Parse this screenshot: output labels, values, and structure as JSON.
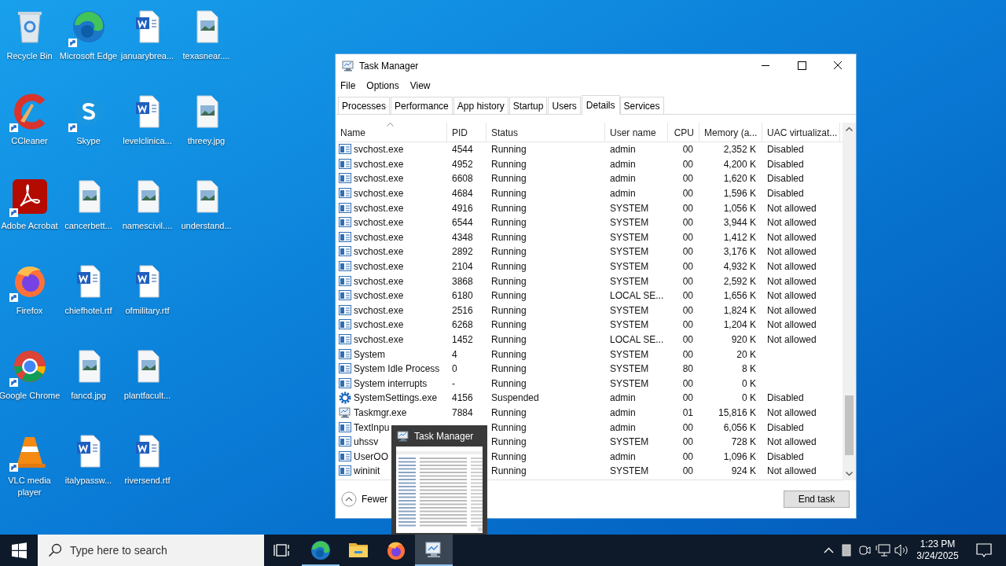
{
  "desktop_icons": [
    {
      "label": "Recycle Bin",
      "kind": "recycle",
      "shortcut": false
    },
    {
      "label": "CCleaner",
      "kind": "ccleaner",
      "shortcut": true
    },
    {
      "label": "Adobe Acrobat",
      "kind": "acrobat",
      "shortcut": true
    },
    {
      "label": "Firefox",
      "kind": "firefox",
      "shortcut": true
    },
    {
      "label": "Google Chrome",
      "kind": "chrome",
      "shortcut": true
    },
    {
      "label": "VLC media player",
      "kind": "vlc",
      "shortcut": true
    },
    {
      "label": "Microsoft Edge",
      "kind": "edge",
      "shortcut": true
    },
    {
      "label": "Skype",
      "kind": "skype",
      "shortcut": true
    },
    {
      "label": "cancerbett...",
      "kind": "image",
      "shortcut": false
    },
    {
      "label": "chiefhotel.rtf",
      "kind": "word",
      "shortcut": false
    },
    {
      "label": "fancd.jpg",
      "kind": "image",
      "shortcut": false
    },
    {
      "label": "italypassw...",
      "kind": "word",
      "shortcut": false
    },
    {
      "label": "januarybrea...",
      "kind": "word",
      "shortcut": false
    },
    {
      "label": "levelclinica...",
      "kind": "word",
      "shortcut": false
    },
    {
      "label": "namescivil....",
      "kind": "image",
      "shortcut": false
    },
    {
      "label": "ofmilitary.rtf",
      "kind": "word",
      "shortcut": false
    },
    {
      "label": "plantfacult...",
      "kind": "image",
      "shortcut": false
    },
    {
      "label": "riversend.rtf",
      "kind": "word",
      "shortcut": false
    },
    {
      "label": "texasnear....",
      "kind": "image",
      "shortcut": false
    },
    {
      "label": "threey.jpg",
      "kind": "image",
      "shortcut": false
    },
    {
      "label": "understand...",
      "kind": "image",
      "shortcut": false
    }
  ],
  "window": {
    "title": "Task Manager",
    "menu": [
      "File",
      "Options",
      "View"
    ],
    "tabs": [
      {
        "label": "Processes",
        "selected": false
      },
      {
        "label": "Performance",
        "selected": false
      },
      {
        "label": "App history",
        "selected": false
      },
      {
        "label": "Startup",
        "selected": false
      },
      {
        "label": "Users",
        "selected": false
      },
      {
        "label": "Details",
        "selected": true
      },
      {
        "label": "Services",
        "selected": false
      }
    ],
    "table": {
      "columns": [
        {
          "label": "Name",
          "sorted": true
        },
        {
          "label": "PID",
          "sorted": false
        },
        {
          "label": "Status",
          "sorted": false
        },
        {
          "label": "User name",
          "sorted": false
        },
        {
          "label": "CPU",
          "sorted": false
        },
        {
          "label": "Memory (a...",
          "sorted": false
        },
        {
          "label": "UAC virtualizat...",
          "sorted": false
        }
      ],
      "rows": [
        {
          "kind": "service",
          "name": "svchost.exe",
          "pid": "4544",
          "status": "Running",
          "user": "admin",
          "cpu": "00",
          "memory": "2,352 K",
          "uac": "Disabled"
        },
        {
          "kind": "service",
          "name": "svchost.exe",
          "pid": "4952",
          "status": "Running",
          "user": "admin",
          "cpu": "00",
          "memory": "4,200 K",
          "uac": "Disabled"
        },
        {
          "kind": "service",
          "name": "svchost.exe",
          "pid": "6608",
          "status": "Running",
          "user": "admin",
          "cpu": "00",
          "memory": "1,620 K",
          "uac": "Disabled"
        },
        {
          "kind": "service",
          "name": "svchost.exe",
          "pid": "4684",
          "status": "Running",
          "user": "admin",
          "cpu": "00",
          "memory": "1,596 K",
          "uac": "Disabled"
        },
        {
          "kind": "service",
          "name": "svchost.exe",
          "pid": "4916",
          "status": "Running",
          "user": "SYSTEM",
          "cpu": "00",
          "memory": "1,056 K",
          "uac": "Not allowed"
        },
        {
          "kind": "service",
          "name": "svchost.exe",
          "pid": "6544",
          "status": "Running",
          "user": "SYSTEM",
          "cpu": "00",
          "memory": "3,944 K",
          "uac": "Not allowed"
        },
        {
          "kind": "service",
          "name": "svchost.exe",
          "pid": "4348",
          "status": "Running",
          "user": "SYSTEM",
          "cpu": "00",
          "memory": "1,412 K",
          "uac": "Not allowed"
        },
        {
          "kind": "service",
          "name": "svchost.exe",
          "pid": "2892",
          "status": "Running",
          "user": "SYSTEM",
          "cpu": "00",
          "memory": "3,176 K",
          "uac": "Not allowed"
        },
        {
          "kind": "service",
          "name": "svchost.exe",
          "pid": "2104",
          "status": "Running",
          "user": "SYSTEM",
          "cpu": "00",
          "memory": "4,932 K",
          "uac": "Not allowed"
        },
        {
          "kind": "service",
          "name": "svchost.exe",
          "pid": "3868",
          "status": "Running",
          "user": "SYSTEM",
          "cpu": "00",
          "memory": "2,592 K",
          "uac": "Not allowed"
        },
        {
          "kind": "service",
          "name": "svchost.exe",
          "pid": "6180",
          "status": "Running",
          "user": "LOCAL SE...",
          "cpu": "00",
          "memory": "1,656 K",
          "uac": "Not allowed"
        },
        {
          "kind": "service",
          "name": "svchost.exe",
          "pid": "2516",
          "status": "Running",
          "user": "SYSTEM",
          "cpu": "00",
          "memory": "1,824 K",
          "uac": "Not allowed"
        },
        {
          "kind": "service",
          "name": "svchost.exe",
          "pid": "6268",
          "status": "Running",
          "user": "SYSTEM",
          "cpu": "00",
          "memory": "1,204 K",
          "uac": "Not allowed"
        },
        {
          "kind": "service",
          "name": "svchost.exe",
          "pid": "1452",
          "status": "Running",
          "user": "LOCAL SE...",
          "cpu": "00",
          "memory": "920 K",
          "uac": "Not allowed"
        },
        {
          "kind": "service",
          "name": "System",
          "pid": "4",
          "status": "Running",
          "user": "SYSTEM",
          "cpu": "00",
          "memory": "20 K"
        },
        {
          "kind": "service",
          "name": "System Idle Process",
          "pid": "0",
          "status": "Running",
          "user": "SYSTEM",
          "cpu": "80",
          "memory": "8 K"
        },
        {
          "kind": "service",
          "name": "System interrupts",
          "pid": "-",
          "status": "Running",
          "user": "SYSTEM",
          "cpu": "00",
          "memory": "0 K"
        },
        {
          "kind": "settings",
          "name": "SystemSettings.exe",
          "pid": "4156",
          "status": "Suspended",
          "user": "admin",
          "cpu": "00",
          "memory": "0 K",
          "uac": "Disabled"
        },
        {
          "kind": "monitor",
          "name": "Taskmgr.exe",
          "pid": "7884",
          "status": "Running",
          "user": "admin",
          "cpu": "01",
          "memory": "15,816 K",
          "uac": "Not allowed"
        },
        {
          "kind": "service",
          "name": "TextInpu",
          "status": "Running",
          "user": "admin",
          "cpu": "00",
          "memory": "6,056 K",
          "uac": "Disabled"
        },
        {
          "kind": "service",
          "name": "uhssv",
          "status": "Running",
          "user": "SYSTEM",
          "cpu": "00",
          "memory": "728 K",
          "uac": "Not allowed"
        },
        {
          "kind": "service",
          "name": "UserOO",
          "status": "Running",
          "user": "admin",
          "cpu": "00",
          "memory": "1,096 K",
          "uac": "Disabled"
        },
        {
          "kind": "service",
          "name": "wininit",
          "status": "Running",
          "user": "SYSTEM",
          "cpu": "00",
          "memory": "924 K",
          "uac": "Not allowed"
        }
      ]
    },
    "fewer_details": "Fewer",
    "end_task": "End task"
  },
  "preview": {
    "title": "Task Manager"
  },
  "taskbar": {
    "search_placeholder": "Type here to search",
    "apps": [
      {
        "kind": "taskview",
        "running": false,
        "selected": false
      },
      {
        "kind": "edge",
        "running": true,
        "selected": false
      },
      {
        "kind": "explorer",
        "running": false,
        "selected": false
      },
      {
        "kind": "firefox",
        "running": false,
        "selected": false
      },
      {
        "kind": "monitor",
        "running": true,
        "selected": true
      }
    ],
    "time": "1:23 PM",
    "date": "3/24/2025"
  }
}
